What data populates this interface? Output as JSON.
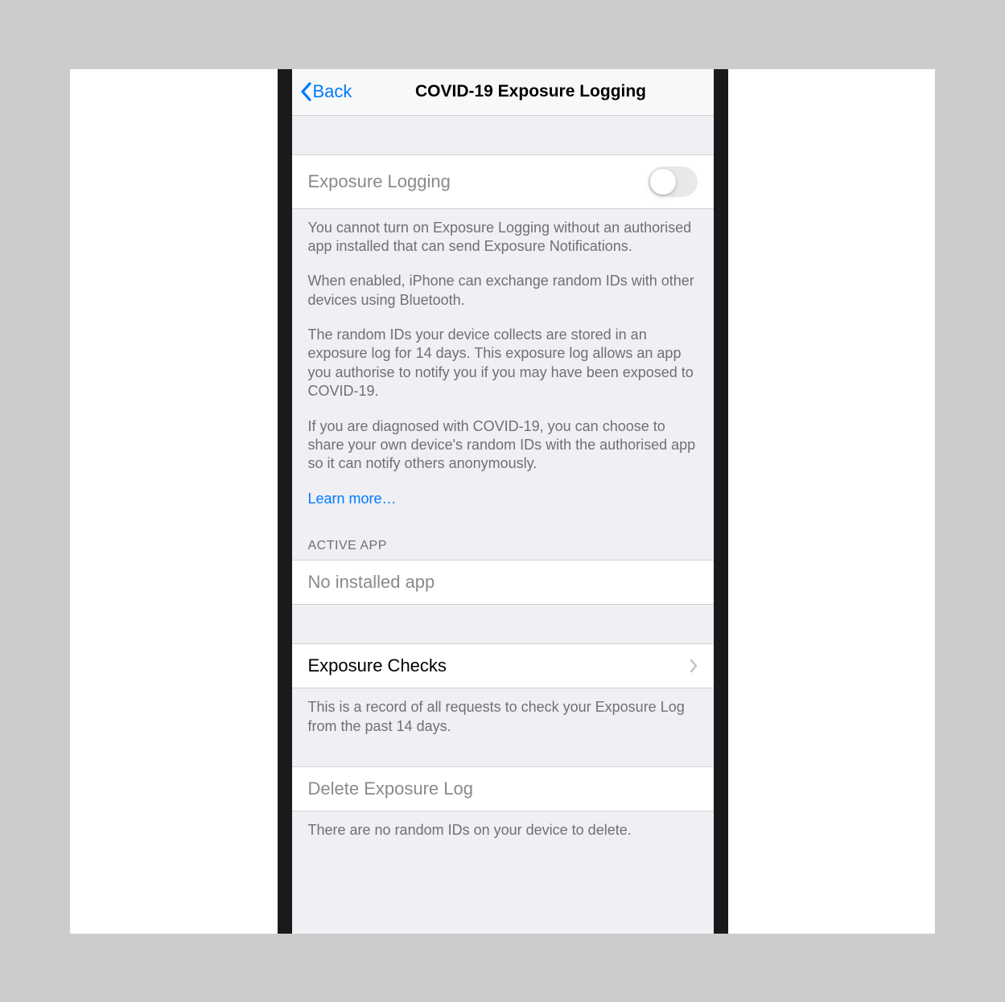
{
  "nav": {
    "back_label": "Back",
    "title": "COVID-19 Exposure Logging"
  },
  "exposure_logging_row": {
    "label": "Exposure Logging",
    "toggle_on": false
  },
  "info": {
    "p1": "You cannot turn on Exposure Logging without an authorised app installed that can send Exposure Notifications.",
    "p2": "When enabled, iPhone can exchange random IDs with other devices using Bluetooth.",
    "p3": "The random IDs your device collects are stored in an exposure log for 14 days. This exposure log allows an app you authorise to notify you if you may have been exposed to COVID-19.",
    "p4": "If you are diagnosed with COVID-19, you can choose to share your own device's random IDs with the authorised app so it can notify others anonymously.",
    "learn_more": "Learn more…"
  },
  "active_app": {
    "header": "ACTIVE APP",
    "value": "No installed app"
  },
  "exposure_checks": {
    "label": "Exposure Checks",
    "footer": "This is a record of all requests to check your Exposure Log from the past 14 days."
  },
  "delete_log": {
    "label": "Delete Exposure Log",
    "footer": "There are no random IDs on your device to delete."
  },
  "colors": {
    "ios_blue": "#007aff",
    "group_bg": "#efeff4",
    "secondary_text": "#707074"
  }
}
